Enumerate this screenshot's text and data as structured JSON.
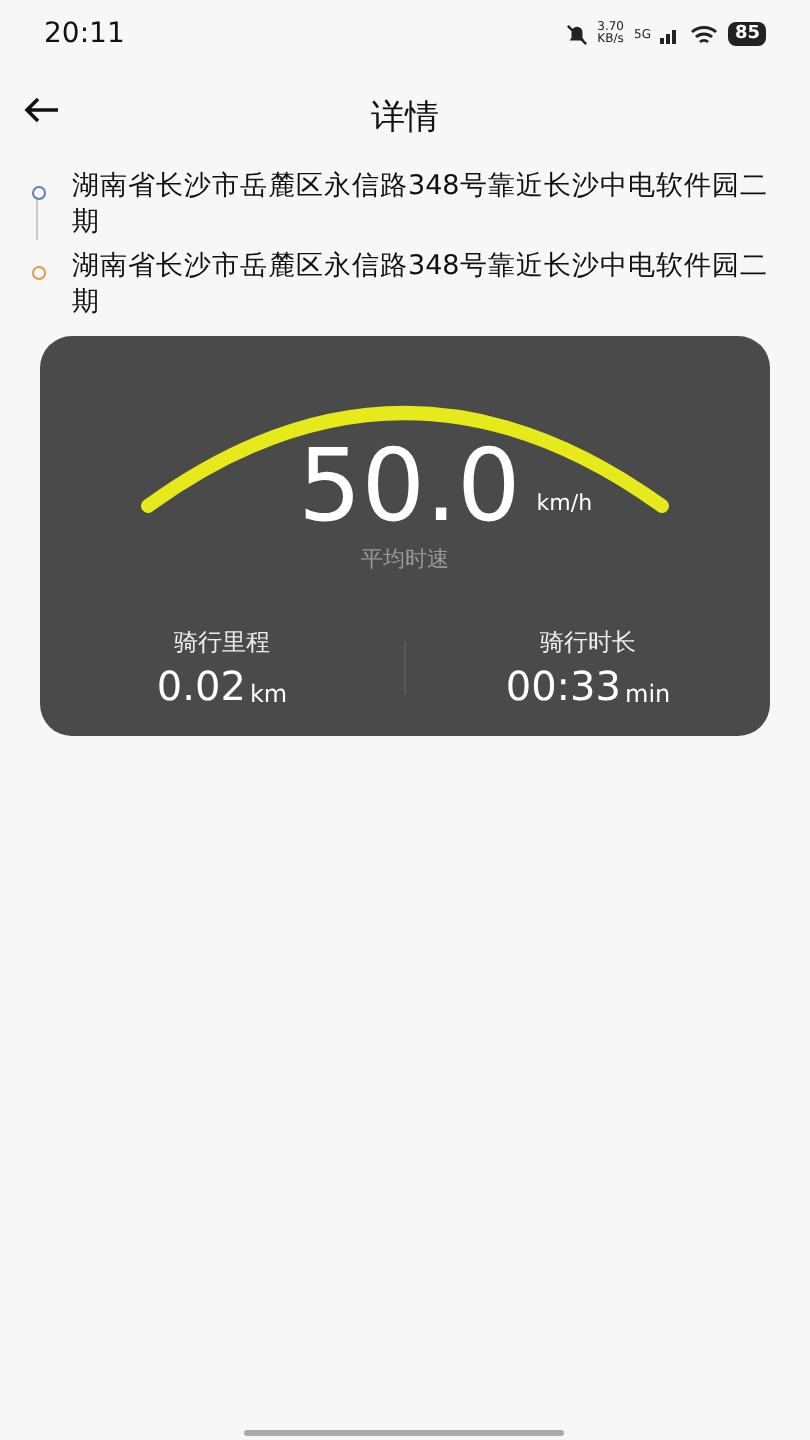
{
  "status_bar": {
    "time": "20:11",
    "net_speed": "3.70",
    "net_unit": "KB/s",
    "network": "5G",
    "battery": "85"
  },
  "header": {
    "title": "详情"
  },
  "route": [
    {
      "address": "湖南省长沙市岳麓区永信路348号靠近长沙中电软件园二期",
      "color": "#5a7dbf"
    },
    {
      "address": "湖南省长沙市岳麓区永信路348号靠近长沙中电软件园二期",
      "color": "#e8954a"
    }
  ],
  "summary": {
    "speed": "50.0",
    "speed_unit": "km/h",
    "speed_label": "平均时速",
    "stats": [
      {
        "label": "骑行里程",
        "value": "0.02",
        "unit": "km"
      },
      {
        "label": "骑行时长",
        "value": "00:33",
        "unit": "min"
      }
    ]
  }
}
